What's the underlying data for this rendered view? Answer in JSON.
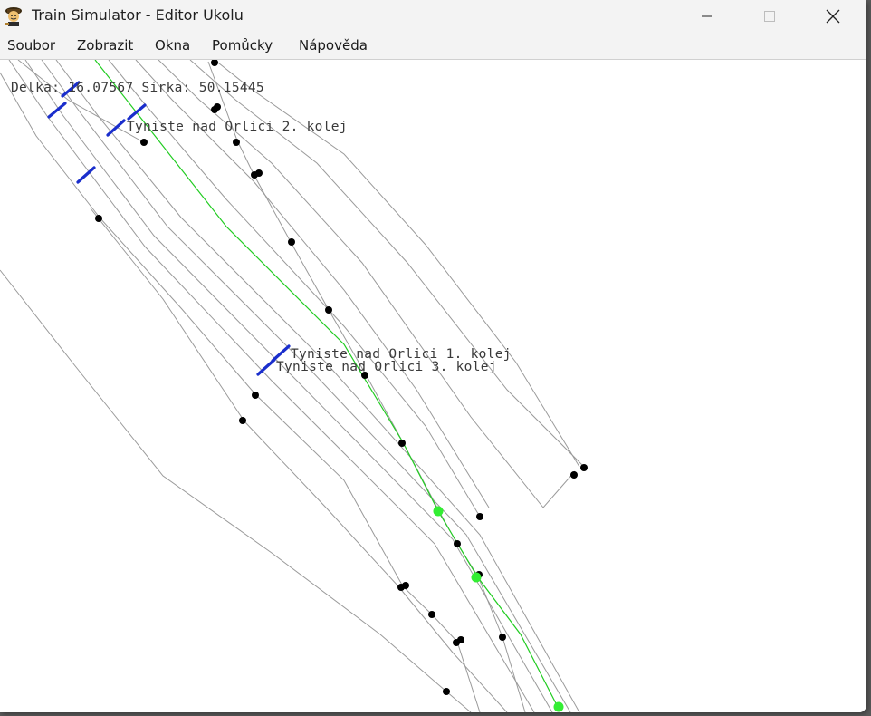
{
  "window": {
    "title": "Train Simulator - Editor Ukolu"
  },
  "menu": {
    "items": [
      {
        "label": "Soubor"
      },
      {
        "label": "Zobrazit"
      },
      {
        "label": "Okna"
      },
      {
        "label": "Pomůcky"
      },
      {
        "label": "Nápověda"
      }
    ]
  },
  "map": {
    "coords": {
      "delka_label": "Delka:",
      "delka_value": "16.07567",
      "sirka_label": "Sirka:",
      "sirka_value": "50.15445"
    },
    "station_labels": [
      "Tyniste nad Orlici 2. kolej",
      "Tyniste nad Orlici 1. kolej",
      "Tyniste nad Orlici 3. kolej"
    ],
    "colors": {
      "track": "#9a9a9a",
      "selected_track": "#22cc22",
      "node": "#000000",
      "selected_node": "#33ee33",
      "signal": "#1a2ecc"
    }
  },
  "icons": {
    "app": "train-engineer-icon",
    "minimize": "minimize-icon",
    "maximize": "maximize-icon",
    "close": "close-icon"
  }
}
